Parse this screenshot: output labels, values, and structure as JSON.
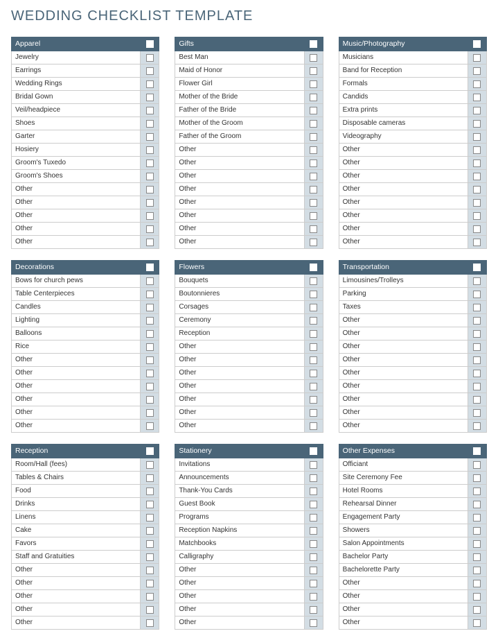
{
  "title": "WEDDING CHECKLIST TEMPLATE",
  "columns": [
    [
      {
        "header": "Apparel",
        "items": [
          "Jewelry",
          "Earrings",
          "Wedding Rings",
          "Bridal Gown",
          "Veil/headpiece",
          "Shoes",
          "Garter",
          "Hosiery",
          "Groom's Tuxedo",
          "Groom's Shoes",
          "Other",
          "Other",
          "Other",
          "Other",
          "Other"
        ]
      },
      {
        "header": "Decorations",
        "items": [
          "Bows for church pews",
          "Table Centerpieces",
          "Candles",
          "Lighting",
          "Balloons",
          "Rice",
          "Other",
          "Other",
          "Other",
          "Other",
          "Other",
          "Other"
        ]
      },
      {
        "header": "Reception",
        "items": [
          "Room/Hall (fees)",
          "Tables & Chairs",
          "Food",
          "Drinks",
          "Linens",
          "Cake",
          "Favors",
          "Staff and Gratuities",
          "Other",
          "Other",
          "Other",
          "Other",
          "Other"
        ]
      }
    ],
    [
      {
        "header": "Gifts",
        "items": [
          "Best Man",
          "Maid of Honor",
          "Flower Girl",
          "Mother of the Bride",
          "Father of the Bride",
          "Mother of the Groom",
          "Father of the Groom",
          "Other",
          "Other",
          "Other",
          "Other",
          "Other",
          "Other",
          "Other",
          "Other"
        ]
      },
      {
        "header": "Flowers",
        "items": [
          "Bouquets",
          "Boutonnieres",
          "Corsages",
          "Ceremony",
          "Reception",
          "Other",
          "Other",
          "Other",
          "Other",
          "Other",
          "Other",
          "Other"
        ]
      },
      {
        "header": "Stationery",
        "items": [
          "Invitations",
          "Announcements",
          "Thank-You Cards",
          "Guest Book",
          "Programs",
          "Reception Napkins",
          "Matchbooks",
          "Calligraphy",
          "Other",
          "Other",
          "Other",
          "Other",
          "Other"
        ]
      }
    ],
    [
      {
        "header": "Music/Photography",
        "items": [
          "Musicians",
          "Band for Reception",
          "Formals",
          "Candids",
          "Extra prints",
          "Disposable cameras",
          "Videography",
          "Other",
          "Other",
          "Other",
          "Other",
          "Other",
          "Other",
          "Other",
          "Other"
        ]
      },
      {
        "header": "Transportation",
        "items": [
          "Limousines/Trolleys",
          "Parking",
          "Taxes",
          "Other",
          "Other",
          "Other",
          "Other",
          "Other",
          "Other",
          "Other",
          "Other",
          "Other"
        ]
      },
      {
        "header": "Other Expenses",
        "items": [
          "Officiant",
          "Site Ceremony Fee",
          "Hotel Rooms",
          "Rehearsal Dinner",
          "Engagement Party",
          "Showers",
          "Salon Appointments",
          "Bachelor Party",
          "Bachelorette Party",
          "Other",
          "Other",
          "Other",
          "Other"
        ]
      }
    ]
  ]
}
